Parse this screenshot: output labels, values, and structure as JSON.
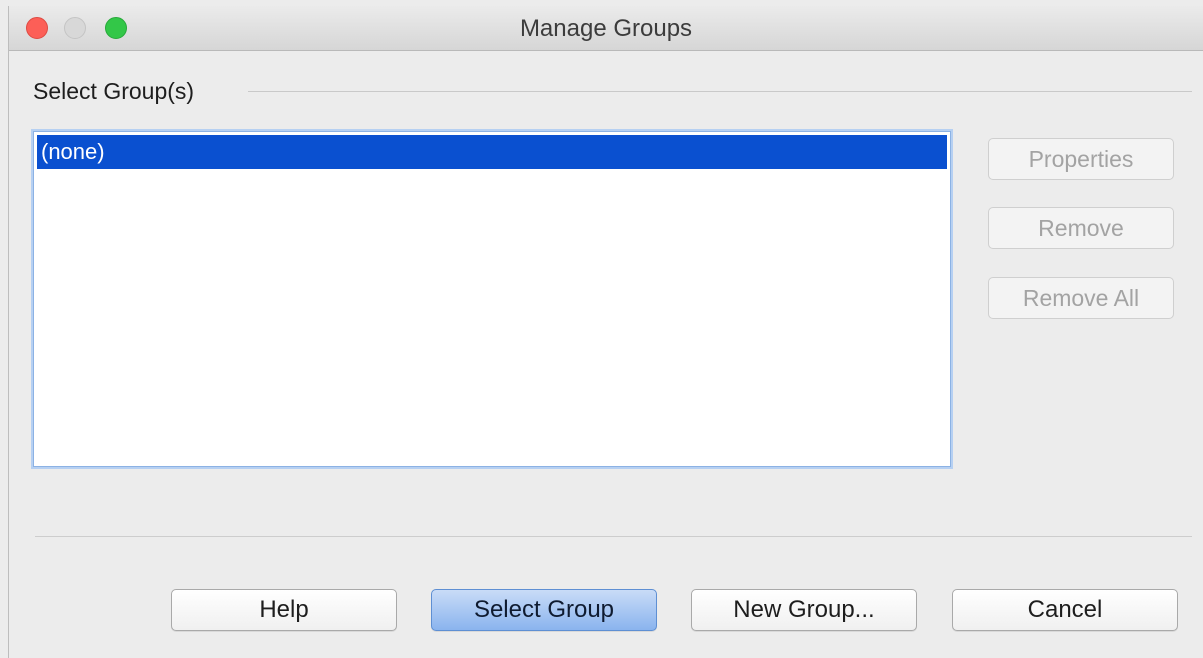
{
  "window": {
    "title": "Manage Groups",
    "controls": {
      "close_color": "#fc5f57",
      "minimize_color": "#d8d8d8",
      "zoom_color": "#33c748"
    }
  },
  "group_section": {
    "label": "Select Group(s)",
    "items": [
      {
        "label": "(none)",
        "selected": true
      }
    ],
    "selection_color": "#0a50d0"
  },
  "side_buttons": {
    "properties": "Properties",
    "remove": "Remove",
    "remove_all": "Remove All"
  },
  "footer": {
    "help": "Help",
    "select_group": "Select Group",
    "new_group": "New Group...",
    "cancel": "Cancel"
  }
}
